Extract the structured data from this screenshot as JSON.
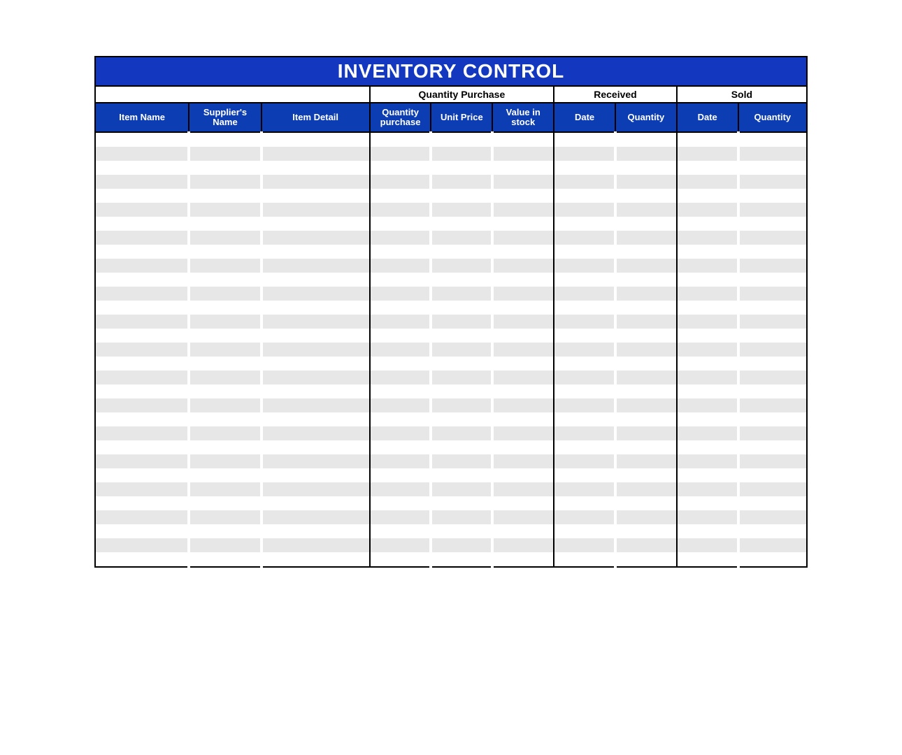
{
  "title": "INVENTORY CONTROL",
  "groups": {
    "blank": "",
    "qty_purchase": "Quantity Purchase",
    "received": "Received",
    "sold": "Sold"
  },
  "columns": {
    "item_name": "Item Name",
    "supplier_name": "Supplier's Name",
    "item_detail": "Item Detail",
    "qty_purchase": "Quantity purchase",
    "unit_price": "Unit Price",
    "value_in_stock": "Value in stock",
    "recv_date": "Date",
    "recv_qty": "Quantity",
    "sold_date": "Date",
    "sold_qty": "Quantity"
  },
  "rows": [
    {
      "item_name": "",
      "supplier_name": "",
      "item_detail": "",
      "qty_purchase": "",
      "unit_price": "",
      "value_in_stock": "",
      "recv_date": "",
      "recv_qty": "",
      "sold_date": "",
      "sold_qty": ""
    },
    {
      "item_name": "",
      "supplier_name": "",
      "item_detail": "",
      "qty_purchase": "",
      "unit_price": "",
      "value_in_stock": "",
      "recv_date": "",
      "recv_qty": "",
      "sold_date": "",
      "sold_qty": ""
    },
    {
      "item_name": "",
      "supplier_name": "",
      "item_detail": "",
      "qty_purchase": "",
      "unit_price": "",
      "value_in_stock": "",
      "recv_date": "",
      "recv_qty": "",
      "sold_date": "",
      "sold_qty": ""
    },
    {
      "item_name": "",
      "supplier_name": "",
      "item_detail": "",
      "qty_purchase": "",
      "unit_price": "",
      "value_in_stock": "",
      "recv_date": "",
      "recv_qty": "",
      "sold_date": "",
      "sold_qty": ""
    },
    {
      "item_name": "",
      "supplier_name": "",
      "item_detail": "",
      "qty_purchase": "",
      "unit_price": "",
      "value_in_stock": "",
      "recv_date": "",
      "recv_qty": "",
      "sold_date": "",
      "sold_qty": ""
    },
    {
      "item_name": "",
      "supplier_name": "",
      "item_detail": "",
      "qty_purchase": "",
      "unit_price": "",
      "value_in_stock": "",
      "recv_date": "",
      "recv_qty": "",
      "sold_date": "",
      "sold_qty": ""
    },
    {
      "item_name": "",
      "supplier_name": "",
      "item_detail": "",
      "qty_purchase": "",
      "unit_price": "",
      "value_in_stock": "",
      "recv_date": "",
      "recv_qty": "",
      "sold_date": "",
      "sold_qty": ""
    },
    {
      "item_name": "",
      "supplier_name": "",
      "item_detail": "",
      "qty_purchase": "",
      "unit_price": "",
      "value_in_stock": "",
      "recv_date": "",
      "recv_qty": "",
      "sold_date": "",
      "sold_qty": ""
    },
    {
      "item_name": "",
      "supplier_name": "",
      "item_detail": "",
      "qty_purchase": "",
      "unit_price": "",
      "value_in_stock": "",
      "recv_date": "",
      "recv_qty": "",
      "sold_date": "",
      "sold_qty": ""
    },
    {
      "item_name": "",
      "supplier_name": "",
      "item_detail": "",
      "qty_purchase": "",
      "unit_price": "",
      "value_in_stock": "",
      "recv_date": "",
      "recv_qty": "",
      "sold_date": "",
      "sold_qty": ""
    },
    {
      "item_name": "",
      "supplier_name": "",
      "item_detail": "",
      "qty_purchase": "",
      "unit_price": "",
      "value_in_stock": "",
      "recv_date": "",
      "recv_qty": "",
      "sold_date": "",
      "sold_qty": ""
    },
    {
      "item_name": "",
      "supplier_name": "",
      "item_detail": "",
      "qty_purchase": "",
      "unit_price": "",
      "value_in_stock": "",
      "recv_date": "",
      "recv_qty": "",
      "sold_date": "",
      "sold_qty": ""
    },
    {
      "item_name": "",
      "supplier_name": "",
      "item_detail": "",
      "qty_purchase": "",
      "unit_price": "",
      "value_in_stock": "",
      "recv_date": "",
      "recv_qty": "",
      "sold_date": "",
      "sold_qty": ""
    },
    {
      "item_name": "",
      "supplier_name": "",
      "item_detail": "",
      "qty_purchase": "",
      "unit_price": "",
      "value_in_stock": "",
      "recv_date": "",
      "recv_qty": "",
      "sold_date": "",
      "sold_qty": ""
    },
    {
      "item_name": "",
      "supplier_name": "",
      "item_detail": "",
      "qty_purchase": "",
      "unit_price": "",
      "value_in_stock": "",
      "recv_date": "",
      "recv_qty": "",
      "sold_date": "",
      "sold_qty": ""
    },
    {
      "item_name": "",
      "supplier_name": "",
      "item_detail": "",
      "qty_purchase": "",
      "unit_price": "",
      "value_in_stock": "",
      "recv_date": "",
      "recv_qty": "",
      "sold_date": "",
      "sold_qty": ""
    },
    {
      "item_name": "",
      "supplier_name": "",
      "item_detail": "",
      "qty_purchase": "",
      "unit_price": "",
      "value_in_stock": "",
      "recv_date": "",
      "recv_qty": "",
      "sold_date": "",
      "sold_qty": ""
    },
    {
      "item_name": "",
      "supplier_name": "",
      "item_detail": "",
      "qty_purchase": "",
      "unit_price": "",
      "value_in_stock": "",
      "recv_date": "",
      "recv_qty": "",
      "sold_date": "",
      "sold_qty": ""
    },
    {
      "item_name": "",
      "supplier_name": "",
      "item_detail": "",
      "qty_purchase": "",
      "unit_price": "",
      "value_in_stock": "",
      "recv_date": "",
      "recv_qty": "",
      "sold_date": "",
      "sold_qty": ""
    },
    {
      "item_name": "",
      "supplier_name": "",
      "item_detail": "",
      "qty_purchase": "",
      "unit_price": "",
      "value_in_stock": "",
      "recv_date": "",
      "recv_qty": "",
      "sold_date": "",
      "sold_qty": ""
    },
    {
      "item_name": "",
      "supplier_name": "",
      "item_detail": "",
      "qty_purchase": "",
      "unit_price": "",
      "value_in_stock": "",
      "recv_date": "",
      "recv_qty": "",
      "sold_date": "",
      "sold_qty": ""
    },
    {
      "item_name": "",
      "supplier_name": "",
      "item_detail": "",
      "qty_purchase": "",
      "unit_price": "",
      "value_in_stock": "",
      "recv_date": "",
      "recv_qty": "",
      "sold_date": "",
      "sold_qty": ""
    },
    {
      "item_name": "",
      "supplier_name": "",
      "item_detail": "",
      "qty_purchase": "",
      "unit_price": "",
      "value_in_stock": "",
      "recv_date": "",
      "recv_qty": "",
      "sold_date": "",
      "sold_qty": ""
    },
    {
      "item_name": "",
      "supplier_name": "",
      "item_detail": "",
      "qty_purchase": "",
      "unit_price": "",
      "value_in_stock": "",
      "recv_date": "",
      "recv_qty": "",
      "sold_date": "",
      "sold_qty": ""
    },
    {
      "item_name": "",
      "supplier_name": "",
      "item_detail": "",
      "qty_purchase": "",
      "unit_price": "",
      "value_in_stock": "",
      "recv_date": "",
      "recv_qty": "",
      "sold_date": "",
      "sold_qty": ""
    },
    {
      "item_name": "",
      "supplier_name": "",
      "item_detail": "",
      "qty_purchase": "",
      "unit_price": "",
      "value_in_stock": "",
      "recv_date": "",
      "recv_qty": "",
      "sold_date": "",
      "sold_qty": ""
    },
    {
      "item_name": "",
      "supplier_name": "",
      "item_detail": "",
      "qty_purchase": "",
      "unit_price": "",
      "value_in_stock": "",
      "recv_date": "",
      "recv_qty": "",
      "sold_date": "",
      "sold_qty": ""
    },
    {
      "item_name": "",
      "supplier_name": "",
      "item_detail": "",
      "qty_purchase": "",
      "unit_price": "",
      "value_in_stock": "",
      "recv_date": "",
      "recv_qty": "",
      "sold_date": "",
      "sold_qty": ""
    },
    {
      "item_name": "",
      "supplier_name": "",
      "item_detail": "",
      "qty_purchase": "",
      "unit_price": "",
      "value_in_stock": "",
      "recv_date": "",
      "recv_qty": "",
      "sold_date": "",
      "sold_qty": ""
    },
    {
      "item_name": "",
      "supplier_name": "",
      "item_detail": "",
      "qty_purchase": "",
      "unit_price": "",
      "value_in_stock": "",
      "recv_date": "",
      "recv_qty": "",
      "sold_date": "",
      "sold_qty": ""
    },
    {
      "item_name": "",
      "supplier_name": "",
      "item_detail": "",
      "qty_purchase": "",
      "unit_price": "",
      "value_in_stock": "",
      "recv_date": "",
      "recv_qty": "",
      "sold_date": "",
      "sold_qty": ""
    }
  ]
}
